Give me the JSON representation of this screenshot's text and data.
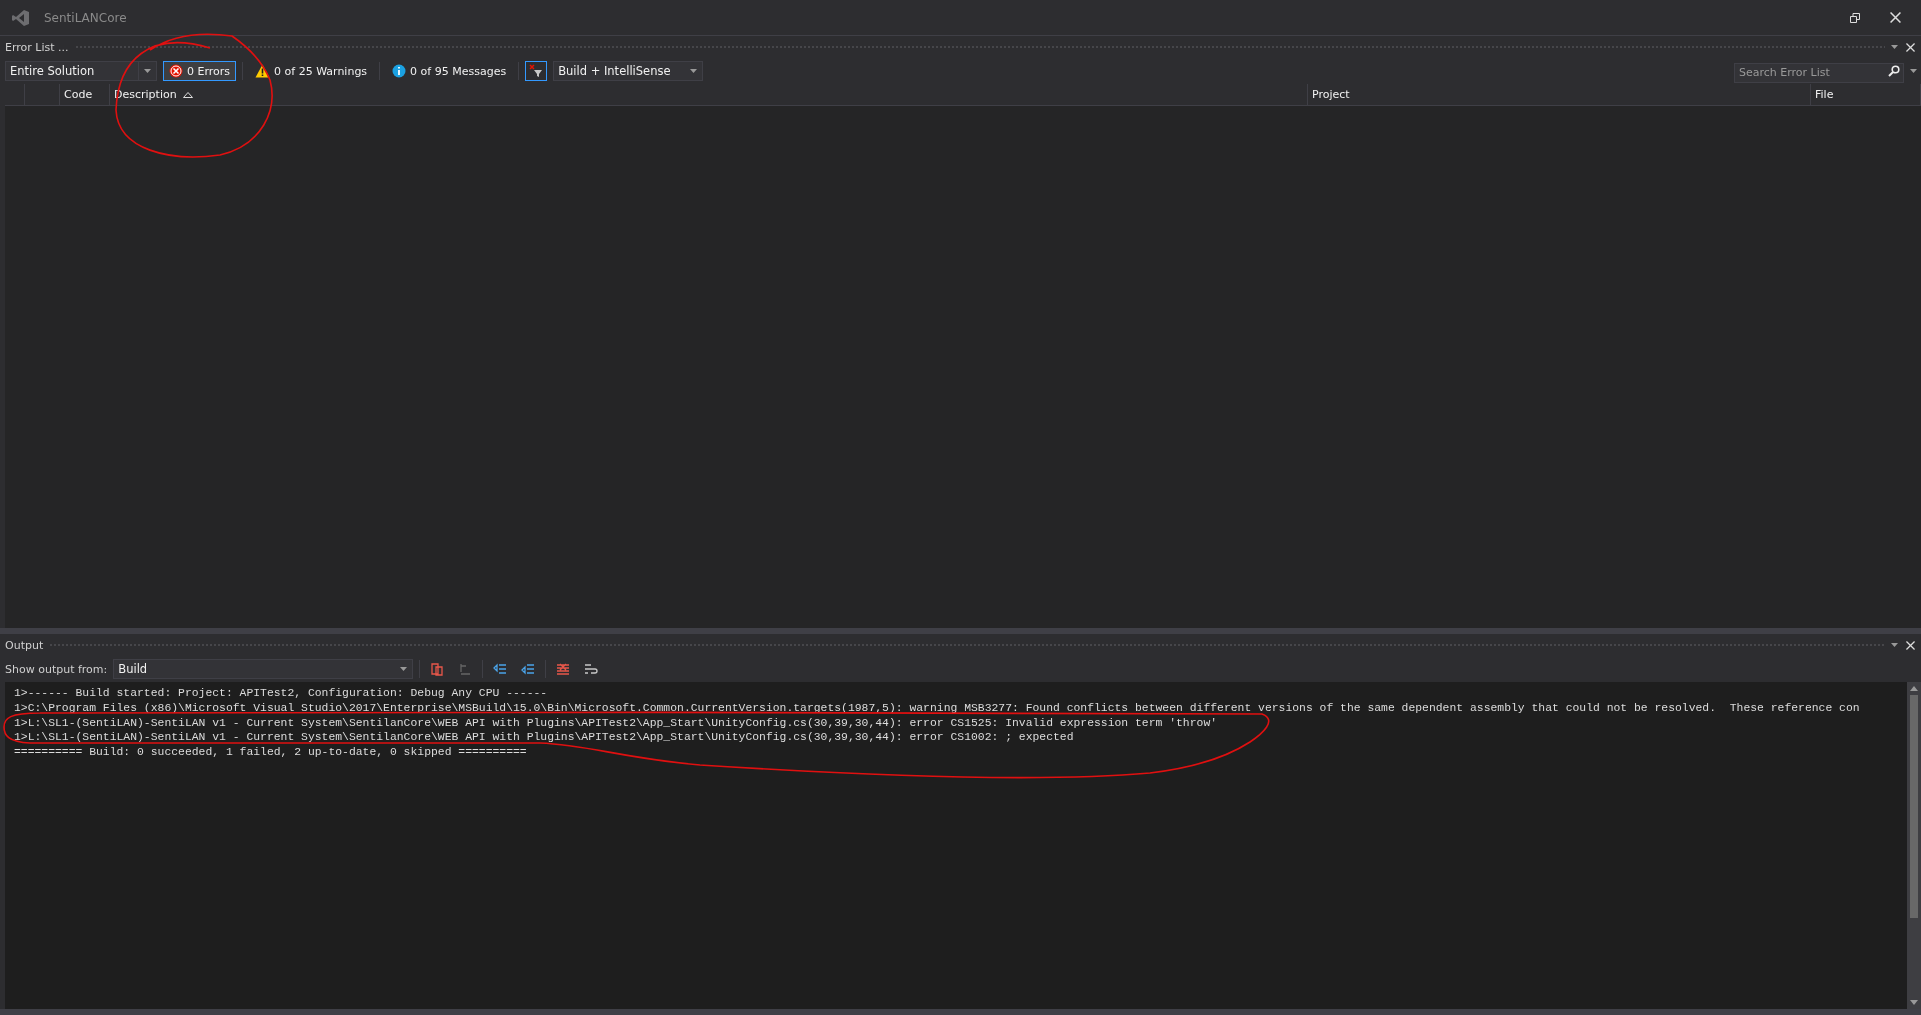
{
  "window": {
    "title": "SentiLANCore"
  },
  "error_list": {
    "title": "Error List ...",
    "scope": "Entire Solution",
    "filters": [
      {
        "kind": "error",
        "label": "0 Errors",
        "selected": true
      },
      {
        "kind": "warning",
        "label": "0 of 25 Warnings",
        "selected": false
      },
      {
        "kind": "info",
        "label": "0 of 95 Messages",
        "selected": false
      }
    ],
    "source": "Build + IntelliSense",
    "search": {
      "placeholder": "Search Error List"
    },
    "columns": [
      {
        "label": "Code",
        "sorted": false
      },
      {
        "label": "Description",
        "sorted": true
      },
      {
        "label": "Project",
        "sorted": false
      },
      {
        "label": "File",
        "sorted": false
      }
    ]
  },
  "output": {
    "title": "Output",
    "source_label": "Show output from:",
    "source": "Build",
    "lines": [
      "1>------ Build started: Project: APITest2, Configuration: Debug Any CPU ------",
      "1>C:\\Program Files (x86)\\Microsoft Visual Studio\\2017\\Enterprise\\MSBuild\\15.0\\Bin\\Microsoft.Common.CurrentVersion.targets(1987,5): warning MSB3277: Found conflicts between different versions of the same dependent assembly that could not be resolved.  These reference con",
      "1>L:\\SL1-(SentiLAN)-SentiLAN v1 - Current System\\SentilanCore\\WEB API with Plugins\\APITest2\\App_Start\\UnityConfig.cs(30,39,30,44): error CS1525: Invalid expression term 'throw'",
      "1>L:\\SL1-(SentiLAN)-SentiLAN v1 - Current System\\SentilanCore\\WEB API with Plugins\\APITest2\\App_Start\\UnityConfig.cs(30,39,30,44): error CS1002: ; expected",
      "========== Build: 0 succeeded, 1 failed, 2 up-to-date, 0 skipped =========="
    ]
  }
}
